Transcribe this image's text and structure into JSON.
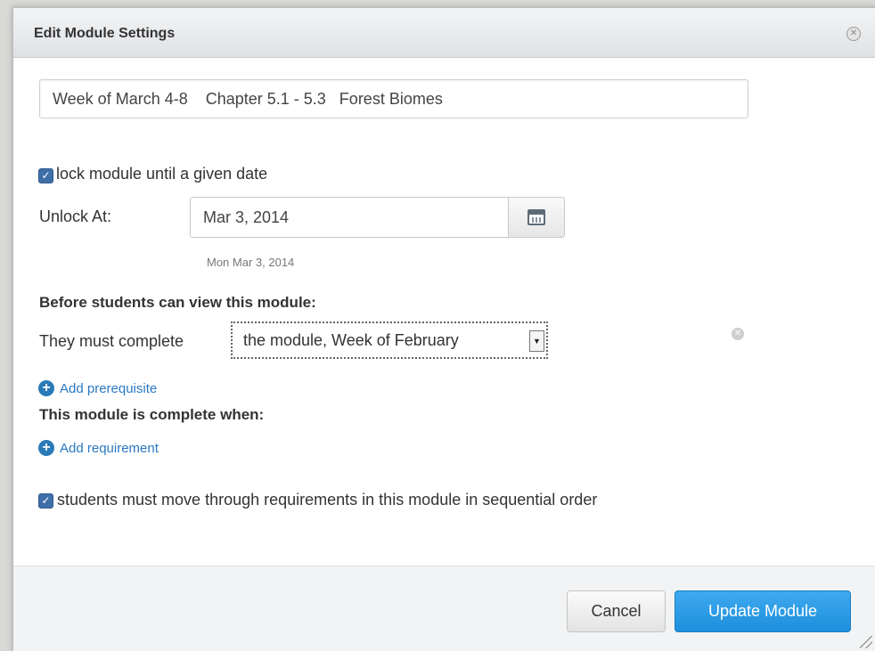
{
  "dialog": {
    "title": "Edit Module Settings",
    "close_icon": "close-icon"
  },
  "module_name": {
    "value": "Week of March 4-8    Chapter 5.1 - 5.3   Forest Biomes"
  },
  "lock": {
    "checked": true,
    "label": "lock module until a given date"
  },
  "unlock": {
    "label": "Unlock At:",
    "value": "Mar 3, 2014",
    "hint": "Mon Mar 3, 2014",
    "calendar_icon": "calendar-icon"
  },
  "prerequisites": {
    "heading": "Before students can view this module:",
    "row_label": "They must complete",
    "selected": "the module, Week of February",
    "add_label": "Add prerequisite"
  },
  "requirements": {
    "heading": "This module is complete when:",
    "add_label": "Add requirement"
  },
  "sequential": {
    "checked": true,
    "label": "students must move through requirements in this module in sequential order"
  },
  "footer": {
    "cancel_label": "Cancel",
    "update_label": "Update Module"
  },
  "colors": {
    "primary": "#1d8fdc",
    "link": "#2a78c2",
    "checkbox": "#3f6fa8"
  }
}
